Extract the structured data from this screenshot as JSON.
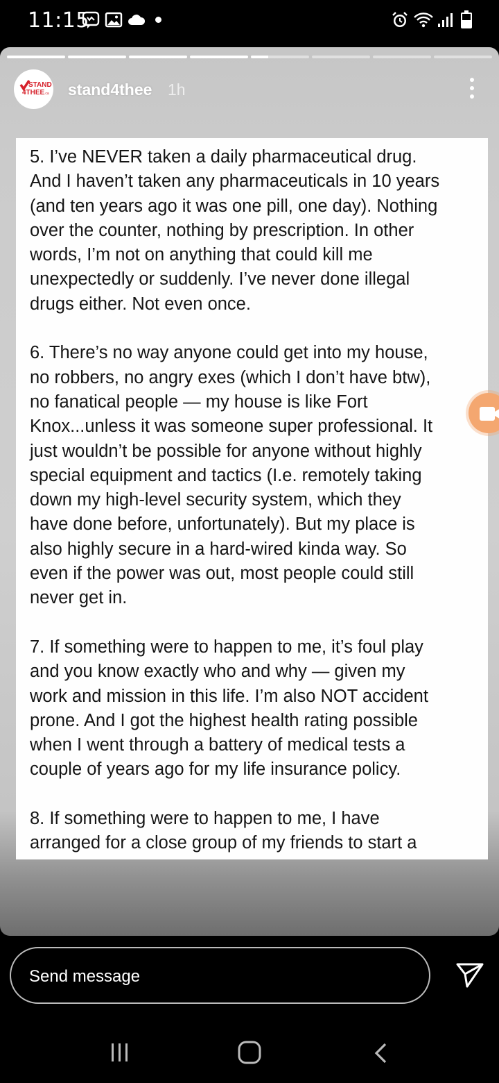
{
  "status_bar": {
    "time": "11:15",
    "icons": [
      "messenger-icon",
      "gallery-icon",
      "cloud-icon",
      "dot-icon",
      "alarm-icon",
      "wifi-icon",
      "signal-icon",
      "battery-icon"
    ]
  },
  "story": {
    "progress_segments": 8,
    "current_segment": 5,
    "current_segment_progress": 0.3,
    "avatar_logo_text": "STAND 4THEE",
    "username": "stand4thee",
    "time_ago": "1h",
    "paragraphs": [
      [
        "5. I’ve NEVER taken a daily pharmaceutical drug.",
        "And I haven’t taken any pharmaceuticals in 10 years",
        "(and ten years ago it was one pill, one day). Nothing",
        "over the counter, nothing by prescription. In other",
        "words, I’m not on anything that could kill me",
        "unexpectedly or suddenly. I’ve never done illegal",
        "drugs either. Not even once."
      ],
      [
        "6. There’s no way anyone could get into my house,",
        "no robbers, no angry exes (which I don’t have btw),",
        "no fanatical people — my house is like Fort",
        "Knox...unless it was someone super professional. It",
        "just wouldn’t be possible for anyone without highly",
        "special equipment and tactics (I.e. remotely taking",
        "down my high-level security system, which they",
        "have done before, unfortunately). But my place is",
        "also highly secure in a hard-wired kinda way. So",
        "even if the power was out, most people could still",
        "never get in."
      ],
      [
        "7. If something were to happen to me, it’s foul play",
        "and you know exactly who and why — given my",
        "work and mission in this life. I’m also NOT accident",
        "prone. And I got the highest health rating possible",
        "when I went through a battery of medical tests a",
        "couple of years ago for my life insurance policy."
      ],
      [
        "8. If something were to happen to me, I have",
        "arranged for a close group of my friends to start a"
      ]
    ]
  },
  "reply": {
    "placeholder": "Send message"
  },
  "colors": {
    "story_background": "#c9c9c9",
    "camera_bubble": "#f4a770",
    "logo_red": "#d6202a"
  }
}
